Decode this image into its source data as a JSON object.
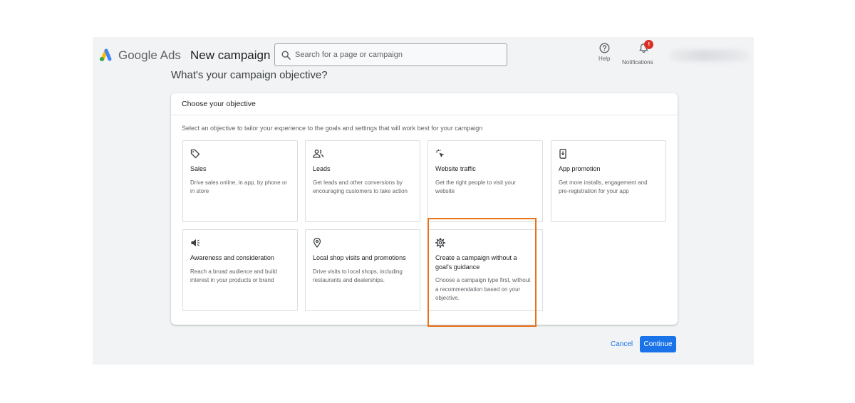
{
  "header": {
    "logo_text": "Google Ads",
    "page_title": "New campaign",
    "search_placeholder": "Search for a page or campaign",
    "help_label": "Help",
    "notifications_label": "Notifications",
    "notifications_badge": "!"
  },
  "main": {
    "question": "What's your campaign objective?",
    "card_title": "Choose your objective",
    "card_subtitle": "Select an objective to tailor your experience to the goals and settings that will work best for your campaign",
    "objectives": [
      {
        "icon": "tag-icon",
        "title": "Sales",
        "description": "Drive sales online, in app, by phone or in store"
      },
      {
        "icon": "people-icon",
        "title": "Leads",
        "description": "Get leads and other conversions by encouraging customers to take action"
      },
      {
        "icon": "cursor-click-icon",
        "title": "Website traffic",
        "description": "Get the right people to visit your website"
      },
      {
        "icon": "phone-download-icon",
        "title": "App promotion",
        "description": "Get more installs, engagement and pre-registration for your app"
      },
      {
        "icon": "megaphone-icon",
        "title": "Awareness and consideration",
        "description": "Reach a broad audience and build interest in your products or brand"
      },
      {
        "icon": "location-pin-icon",
        "title": "Local shop visits and promotions",
        "description": "Drive visits to local shops, including restaurants and dealerships."
      },
      {
        "icon": "gear-icon",
        "title": "Create a campaign without a goal's guidance",
        "description": "Choose a campaign type first, without a recommendation based on your objective."
      }
    ]
  },
  "footer": {
    "cancel_label": "Cancel",
    "continue_label": "Continue"
  },
  "colors": {
    "primary": "#1a73e8",
    "highlight": "#e8711a",
    "badge": "#d93025"
  }
}
